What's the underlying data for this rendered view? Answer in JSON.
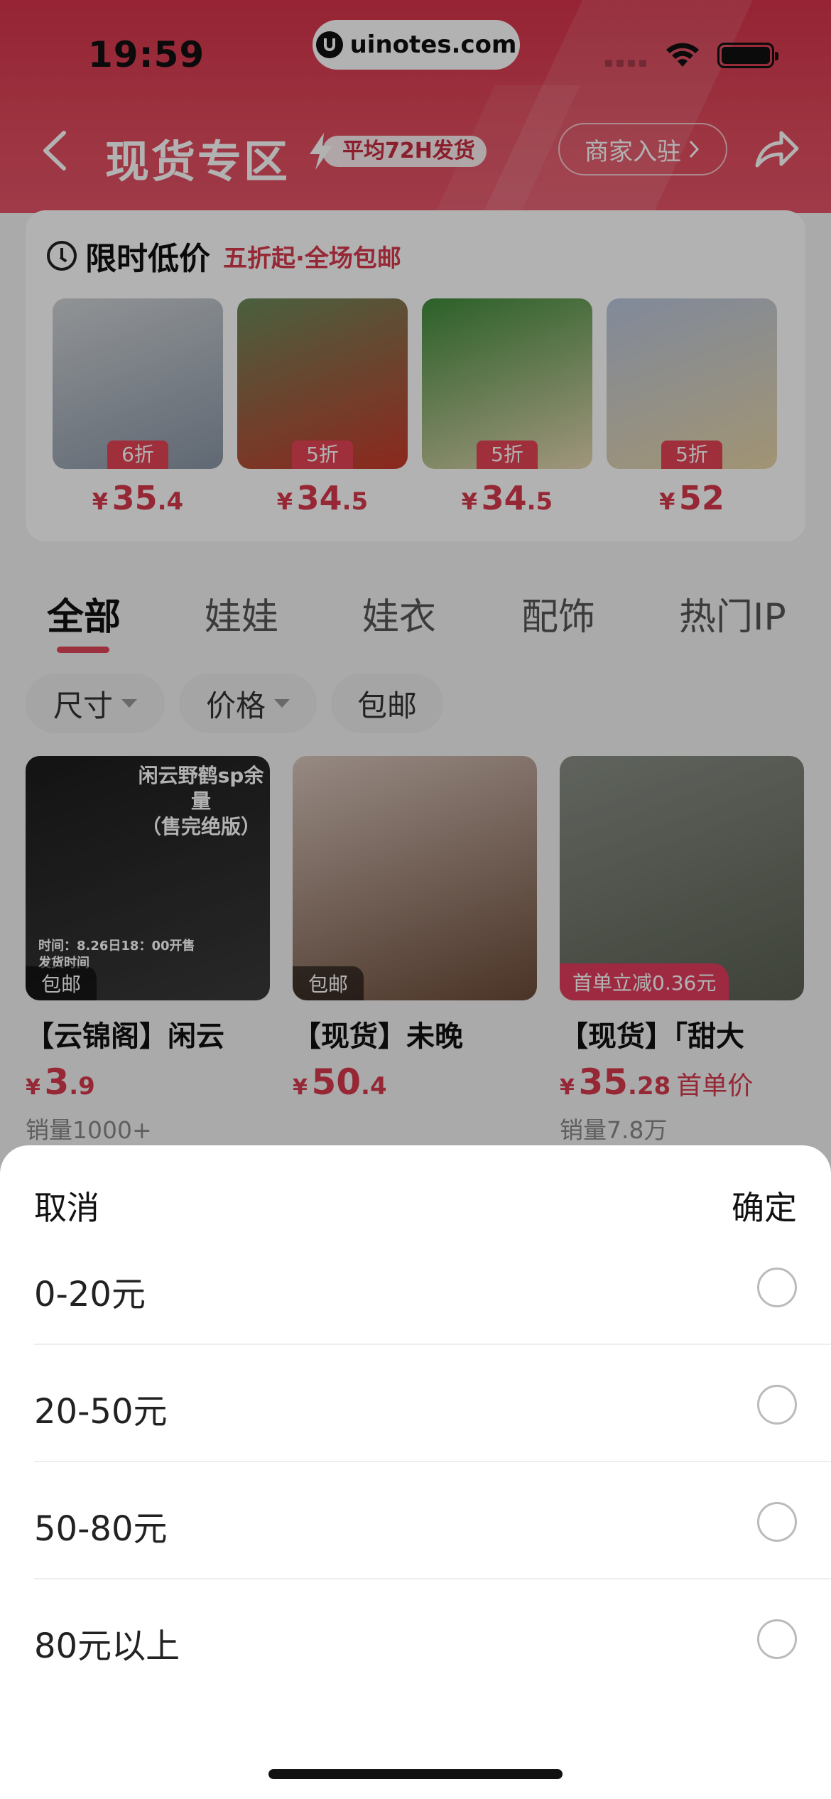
{
  "status_bar": {
    "time": "19:59",
    "url": "uinotes.com"
  },
  "header": {
    "title": "现货专区",
    "badge": "平均72H发货",
    "merchant_button": "商家入驻"
  },
  "flash_sale": {
    "title": "限时低价",
    "subtitle": "五折起·全场包邮",
    "items": [
      {
        "discount": "6折",
        "currency": "¥",
        "price_int": "35",
        "price_dec": ".4",
        "colors": [
          "#cfd3d6",
          "#8a96a6"
        ]
      },
      {
        "discount": "5折",
        "currency": "¥",
        "price_int": "34",
        "price_dec": ".5",
        "colors": [
          "#6a8a5a",
          "#c93a2b"
        ]
      },
      {
        "discount": "5折",
        "currency": "¥",
        "price_int": "34",
        "price_dec": ".5",
        "colors": [
          "#3f8b3b",
          "#e7d7b3"
        ]
      },
      {
        "discount": "5折",
        "currency": "¥",
        "price_int": "52",
        "price_dec": "",
        "colors": [
          "#b9c6de",
          "#e7d4a6"
        ]
      }
    ]
  },
  "tabs": [
    "全部",
    "娃娃",
    "娃衣",
    "配饰",
    "热门IP"
  ],
  "filters": [
    "尺寸",
    "价格",
    "包邮"
  ],
  "products": [
    {
      "name": "【云锦阁】闲云",
      "label": "包邮",
      "currency": "¥",
      "price_int": "3",
      "price_dec": ".9",
      "note": "",
      "sales": "销量1000+",
      "overlay_text": [
        "闲云野鹤sp余量",
        "（售完绝版）",
        "时间：8.26日18：00开售",
        "发货时间"
      ],
      "colors": [
        "#1c1c1c",
        "#3a3a3a"
      ]
    },
    {
      "name": "【现货】未晚",
      "label": "包邮",
      "currency": "¥",
      "price_int": "50",
      "price_dec": ".4",
      "note": "",
      "sales": "",
      "overlay_text": [],
      "colors": [
        "#d8c6bc",
        "#6b4a38"
      ]
    },
    {
      "name": "【现货】「甜大",
      "label": "首单立减0.36元",
      "currency": "¥",
      "price_int": "35",
      "price_dec": ".28",
      "note": "首单价",
      "sales": "销量7.8万",
      "overlay_text": [],
      "colors": [
        "#8a8f86",
        "#5a6052"
      ]
    }
  ],
  "sheet": {
    "cancel": "取消",
    "confirm": "确定",
    "options": [
      "0-20元",
      "20-50元",
      "50-80元",
      "80元以上"
    ]
  },
  "colors": {
    "accent": "#e04659",
    "price": "#d73a4e"
  }
}
